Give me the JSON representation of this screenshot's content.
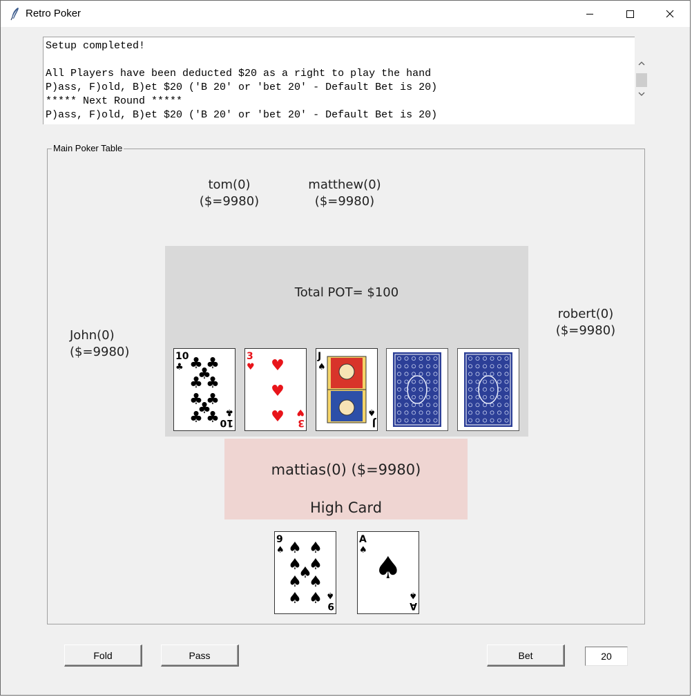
{
  "window": {
    "title": "Retro Poker",
    "app_icon": "feather-icon",
    "controls": [
      "minimize-icon",
      "maximize-icon",
      "close-icon"
    ]
  },
  "log": {
    "lines": [
      "Setup completed!",
      "",
      "All Players have been deducted $20 as a right to play the hand",
      "P)ass, F)old, B)et $20 ('B 20' or 'bet 20' - Default Bet is 20)",
      "***** Next Round *****",
      "P)ass, F)old, B)et $20 ('B 20' or 'bet 20' - Default Bet is 20)"
    ]
  },
  "table": {
    "title": "Main Poker Table",
    "pot_label": "Total POT= $100",
    "players": {
      "tom": {
        "name": "tom(0)",
        "money": "($=9980)"
      },
      "matthew": {
        "name": "matthew(0)",
        "money": "($=9980)"
      },
      "john": {
        "name": "John(0)",
        "money": "($=9980)"
      },
      "robert": {
        "name": "robert(0)",
        "money": "($=9980)"
      }
    },
    "community_cards": [
      {
        "rank": "10",
        "suit": "♣",
        "color": "#000000",
        "face_up": true
      },
      {
        "rank": "3",
        "suit": "♥",
        "color": "#e8141a",
        "face_up": true
      },
      {
        "rank": "J",
        "suit": "♠",
        "color": "#000000",
        "face_up": true
      },
      {
        "face_up": false
      },
      {
        "face_up": false
      }
    ],
    "me": {
      "label": "mattias(0) ($=9980)",
      "hand_rank": "High Card",
      "cards": [
        {
          "rank": "9",
          "suit": "♠",
          "color": "#000000"
        },
        {
          "rank": "A",
          "suit": "♠",
          "color": "#000000"
        }
      ]
    }
  },
  "controls": {
    "fold_label": "Fold",
    "pass_label": "Pass",
    "bet_label": "Bet",
    "bet_value": "20"
  },
  "colors": {
    "pot_bg": "#d9d9d9",
    "me_bg": "#efd5d2",
    "card_back": "#2c3f97"
  }
}
